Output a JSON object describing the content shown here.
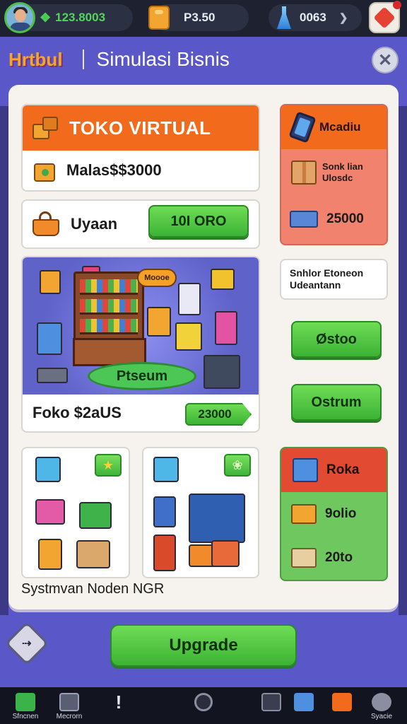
{
  "topbar": {
    "cash": "123.8003",
    "coins": "P3.50",
    "gems": "0063",
    "gems_dropdown": "❯"
  },
  "header": {
    "brand": "Hrtbul",
    "title": "Simulasi Bisnis",
    "close": "✕"
  },
  "left": {
    "toko_title": "TOKO VIRTUAL",
    "toko_price": "Malas$$3000",
    "uyaan_label": "Uyaan",
    "uyaan_button": "10I ORO",
    "scene_sign": "Moooe",
    "scene_platform": "Ptseum",
    "scene_footer_label": "Foko $2aUS",
    "scene_footer_button": "23000",
    "caption": "Systmvan Noden NGR"
  },
  "right": {
    "card1_title": "Mcadiu",
    "card1_row_label": "Sonk lian\nUlosdc",
    "card1_row_value": "25000",
    "card2_label": "Snhlor Etoneon\nUdeantann",
    "button1": "Østoo",
    "button2": "Ostrum",
    "card3_title": "Roka",
    "card3_row1": "9olio",
    "card3_row2": "20to"
  },
  "upgrade": "Upgrade",
  "nav": {
    "items": [
      {
        "label": "Sfncnen",
        "icon": "store-icon",
        "color": "#3cb34a"
      },
      {
        "label": "Mecrorn",
        "icon": "box-icon",
        "color": "#5a5e72"
      },
      {
        "label": "",
        "icon": "alert-icon",
        "color": "#e8e8f0"
      },
      {
        "label": "",
        "icon": "home-icon",
        "color": "#8a8ea0"
      },
      {
        "label": "",
        "icon": "clipboard-icon",
        "color": "#5a5e72"
      },
      {
        "label": "",
        "icon": "shop-icon",
        "color": "#4f8fe0"
      },
      {
        "label": "",
        "icon": "pin-icon",
        "color": "#f26b1d"
      },
      {
        "label": "Syacie",
        "icon": "settings-icon",
        "color": "#8a8ea0"
      }
    ]
  },
  "colors": {
    "background": "#5a57c9",
    "orange": "#f26b1d",
    "green": "#3cb335",
    "panel": "#f6f3ee"
  }
}
